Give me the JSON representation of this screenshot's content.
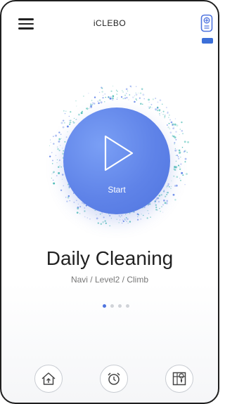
{
  "header": {
    "brand": "iCLEBO",
    "menu_icon": "hamburger-menu-icon",
    "remote_icon": "remote-control-icon",
    "battery_icon": "battery-icon"
  },
  "main": {
    "start_label": "Start",
    "mode_title": "Daily Cleaning",
    "mode_subtitle": "Navi / Level2 / Climb",
    "pager": {
      "pages": 4,
      "active": 1
    }
  },
  "bottom_nav": [
    {
      "icon": "home-icon"
    },
    {
      "icon": "alarm-clock-icon"
    },
    {
      "icon": "map-icon"
    }
  ],
  "colors": {
    "accent": "#5f83e8",
    "battery": "#3c6fd8",
    "particles_teal": "#3fb8b0",
    "particles_blue": "#5f83e8"
  }
}
